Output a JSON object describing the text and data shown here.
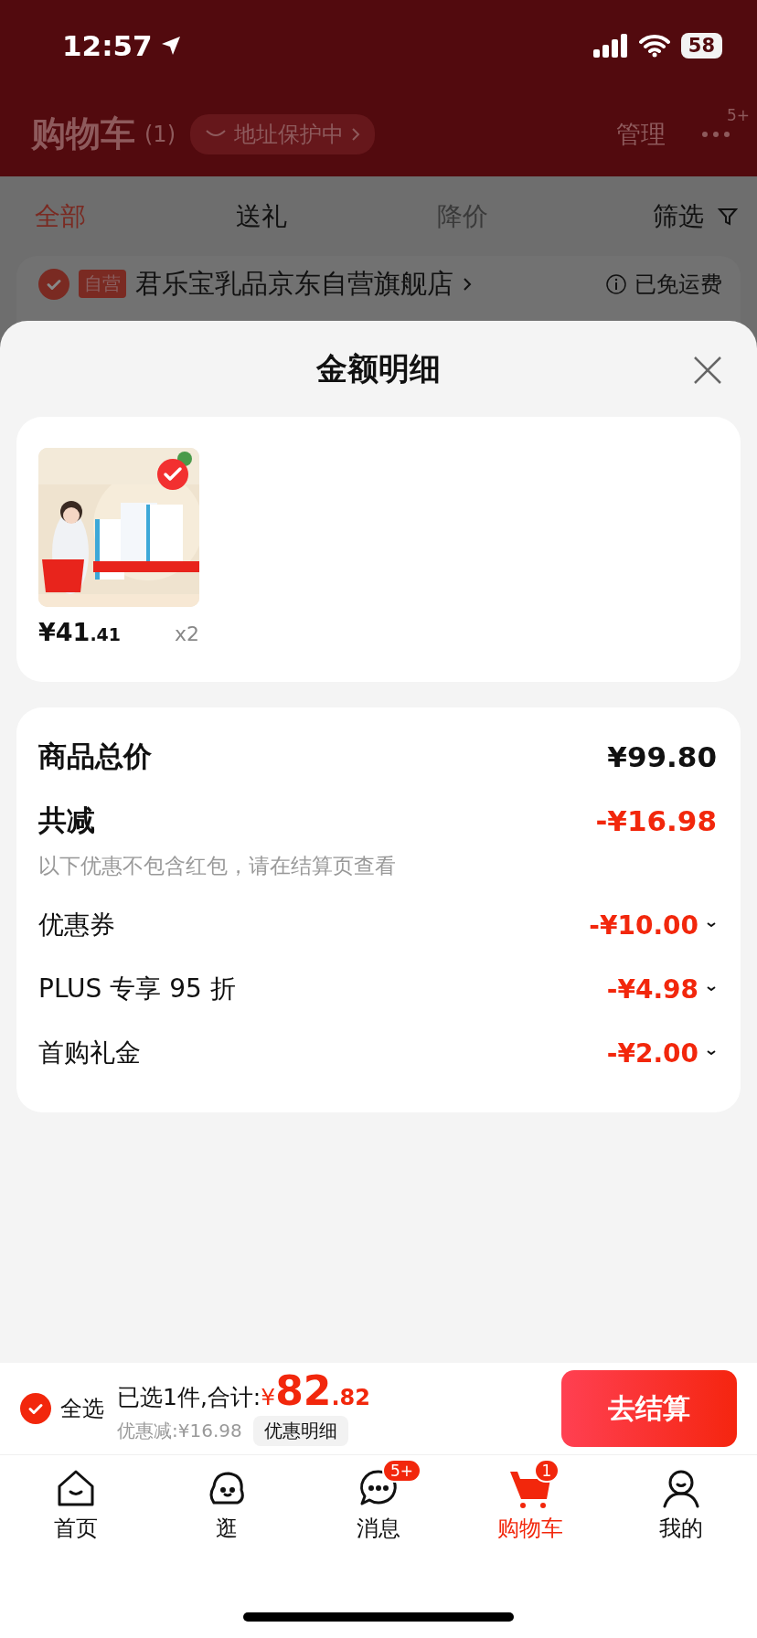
{
  "status_bar": {
    "time": "12:57",
    "battery": "58"
  },
  "header": {
    "title": "购物车",
    "count": "(1)",
    "address_badge": "地址保护中",
    "manage": "管理",
    "more_badge": "5+"
  },
  "filter_tabs": [
    {
      "label": "全部",
      "selected": true,
      "disabled": false
    },
    {
      "label": "送礼",
      "selected": false,
      "disabled": false
    },
    {
      "label": "降价",
      "selected": false,
      "disabled": true
    }
  ],
  "filter_button": "筛选",
  "store": {
    "checked": true,
    "tag": "自营",
    "name": "君乐宝乳品京东自营旗舰店",
    "shipping": "已免运费"
  },
  "sheet": {
    "title": "金额明细",
    "product": {
      "kind": "picture",
      "selected": true,
      "price_main": "¥41",
      "price_decimal": ".41",
      "quantity": "x2"
    },
    "summary": {
      "total_label": "商品总价",
      "total_value": "¥99.80",
      "reduction_label": "共减",
      "reduction_value": "-¥16.98",
      "note": "以下优惠不包含红包，请在结算页查看",
      "discounts": [
        {
          "label": "优惠券",
          "amount": "-¥10.00"
        },
        {
          "label": "PLUS 专享 95 折",
          "amount": "-¥4.98"
        },
        {
          "label": "首购礼金",
          "amount": "-¥2.00"
        }
      ]
    }
  },
  "checkout_bar": {
    "select_all": {
      "checked": true,
      "label": "全选"
    },
    "selected_text": "已选1件,合计:",
    "currency": "¥",
    "total_integer": "82",
    "total_decimal": ".82",
    "discount_text": "优惠减:¥16.98",
    "detail_button": "优惠明细",
    "checkout_button": "去结算"
  },
  "nav": [
    {
      "label": "首页",
      "kind": "home",
      "selected": false
    },
    {
      "label": "逛",
      "kind": "blob",
      "selected": false
    },
    {
      "label": "消息",
      "kind": "chat",
      "selected": false,
      "badge": "5+"
    },
    {
      "label": "购物车",
      "kind": "cart",
      "selected": true,
      "badge": "1"
    },
    {
      "label": "我的",
      "kind": "person",
      "selected": false
    }
  ]
}
